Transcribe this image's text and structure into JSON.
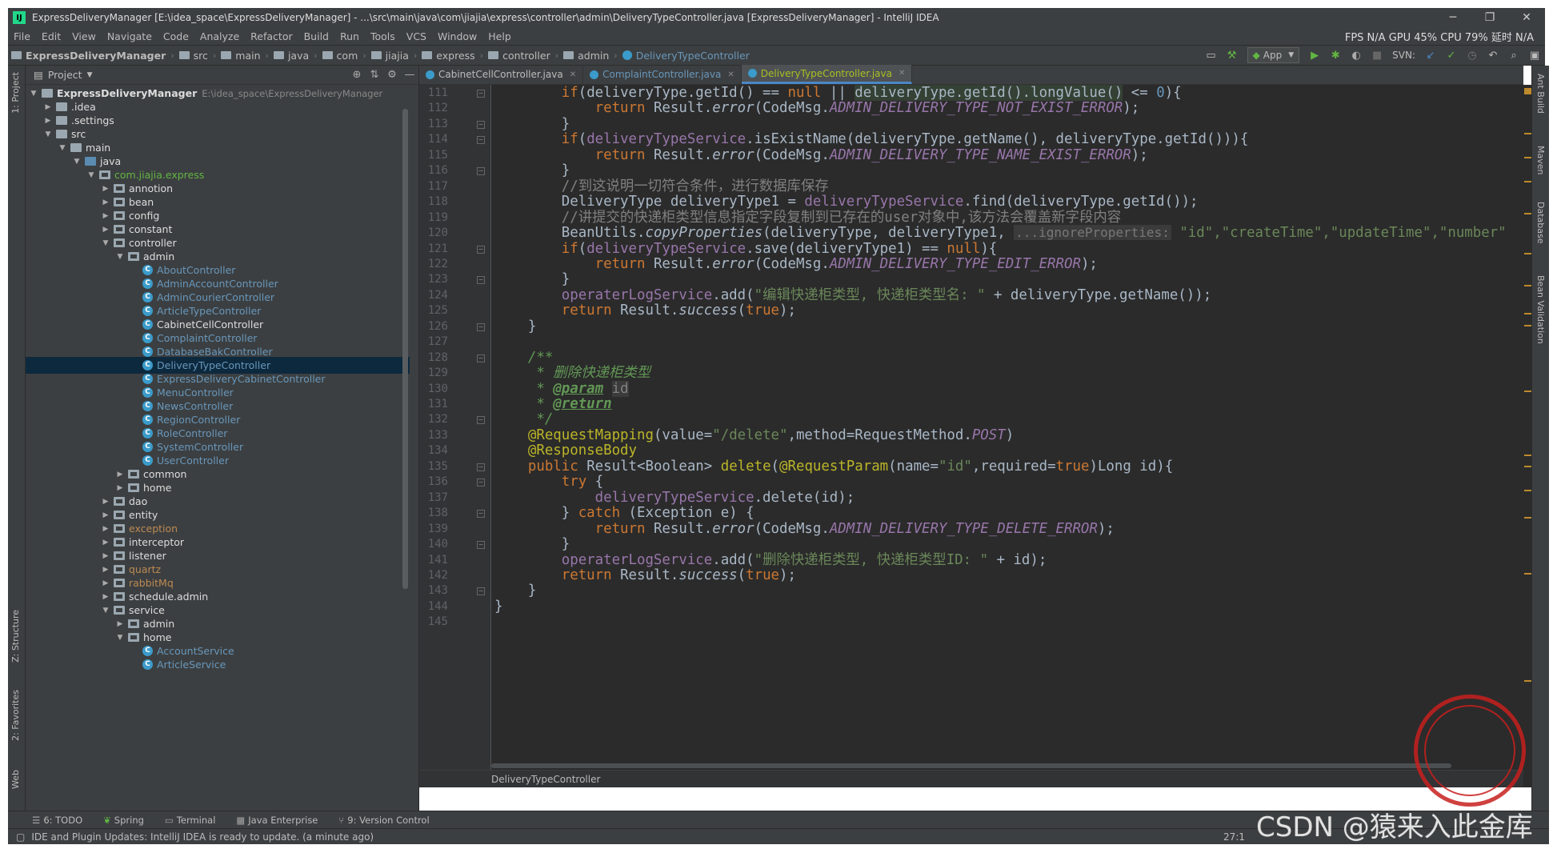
{
  "window": {
    "title": "ExpressDeliveryManager [E:\\idea_space\\ExpressDeliveryManager] - ...\\src\\main\\java\\com\\jiajia\\express\\controller\\admin\\DeliveryTypeController.java [ExpressDeliveryManager] - IntelliJ IDEA",
    "minimize": "─",
    "restore": "❐",
    "close": "✕"
  },
  "menu": {
    "items": [
      "File",
      "Edit",
      "View",
      "Navigate",
      "Code",
      "Analyze",
      "Refactor",
      "Build",
      "Run",
      "Tools",
      "VCS",
      "Window",
      "Help"
    ],
    "stats": "FPS  N/A  GPU  45%  CPU  79%  延时  N/A"
  },
  "nav": {
    "crumbs": [
      "ExpressDeliveryManager",
      "src",
      "main",
      "java",
      "com",
      "jiajia",
      "express",
      "controller",
      "admin",
      "DeliveryTypeController"
    ],
    "run_config": "App",
    "svn_label": "SVN:"
  },
  "left_stripe": {
    "project": "1: Project",
    "structure": "Z: Structure",
    "favorites": "2: Favorites",
    "web": "Web"
  },
  "project_panel": {
    "header": "Project",
    "root_name": "ExpressDeliveryManager",
    "root_path": "E:\\idea_space\\ExpressDeliveryManager",
    "tree": [
      {
        "label": ".idea",
        "indent": 1,
        "arrow": "▶",
        "icon": "folder",
        "color": "white"
      },
      {
        "label": ".settings",
        "indent": 1,
        "arrow": "▶",
        "icon": "folder",
        "color": "white"
      },
      {
        "label": "src",
        "indent": 1,
        "arrow": "▼",
        "icon": "folder",
        "color": "white"
      },
      {
        "label": "main",
        "indent": 2,
        "arrow": "▼",
        "icon": "folder",
        "color": "white"
      },
      {
        "label": "java",
        "indent": 3,
        "arrow": "▼",
        "icon": "src",
        "color": "white"
      },
      {
        "label": "com.jiajia.express",
        "indent": 4,
        "arrow": "▼",
        "icon": "pkg",
        "color": "green"
      },
      {
        "label": "annotion",
        "indent": 5,
        "arrow": "▶",
        "icon": "pkg",
        "color": "white"
      },
      {
        "label": "bean",
        "indent": 5,
        "arrow": "▶",
        "icon": "pkg",
        "color": "white"
      },
      {
        "label": "config",
        "indent": 5,
        "arrow": "▶",
        "icon": "pkg",
        "color": "white"
      },
      {
        "label": "constant",
        "indent": 5,
        "arrow": "▶",
        "icon": "pkg",
        "color": "white"
      },
      {
        "label": "controller",
        "indent": 5,
        "arrow": "▼",
        "icon": "pkg",
        "color": "white"
      },
      {
        "label": "admin",
        "indent": 6,
        "arrow": "▼",
        "icon": "pkg",
        "color": "white"
      },
      {
        "label": "AboutController",
        "indent": 7,
        "arrow": "",
        "icon": "class",
        "color": "blue"
      },
      {
        "label": "AdminAccountController",
        "indent": 7,
        "arrow": "",
        "icon": "class",
        "color": "blue"
      },
      {
        "label": "AdminCourierController",
        "indent": 7,
        "arrow": "",
        "icon": "class",
        "color": "blue"
      },
      {
        "label": "ArticleTypeController",
        "indent": 7,
        "arrow": "",
        "icon": "class",
        "color": "blue"
      },
      {
        "label": "CabinetCellController",
        "indent": 7,
        "arrow": "",
        "icon": "class",
        "color": "white"
      },
      {
        "label": "ComplaintController",
        "indent": 7,
        "arrow": "",
        "icon": "class",
        "color": "blue"
      },
      {
        "label": "DatabaseBakController",
        "indent": 7,
        "arrow": "",
        "icon": "class",
        "color": "blue"
      },
      {
        "label": "DeliveryTypeController",
        "indent": 7,
        "arrow": "",
        "icon": "class",
        "color": "blue",
        "selected": true
      },
      {
        "label": "ExpressDeliveryCabinetController",
        "indent": 7,
        "arrow": "",
        "icon": "class",
        "color": "blue"
      },
      {
        "label": "MenuController",
        "indent": 7,
        "arrow": "",
        "icon": "class",
        "color": "blue"
      },
      {
        "label": "NewsController",
        "indent": 7,
        "arrow": "",
        "icon": "class",
        "color": "blue"
      },
      {
        "label": "RegionController",
        "indent": 7,
        "arrow": "",
        "icon": "class",
        "color": "blue"
      },
      {
        "label": "RoleController",
        "indent": 7,
        "arrow": "",
        "icon": "class",
        "color": "blue"
      },
      {
        "label": "SystemController",
        "indent": 7,
        "arrow": "",
        "icon": "class",
        "color": "blue"
      },
      {
        "label": "UserController",
        "indent": 7,
        "arrow": "",
        "icon": "class",
        "color": "blue"
      },
      {
        "label": "common",
        "indent": 6,
        "arrow": "▶",
        "icon": "pkg",
        "color": "white"
      },
      {
        "label": "home",
        "indent": 6,
        "arrow": "▶",
        "icon": "pkg",
        "color": "white"
      },
      {
        "label": "dao",
        "indent": 5,
        "arrow": "▶",
        "icon": "pkg",
        "color": "white"
      },
      {
        "label": "entity",
        "indent": 5,
        "arrow": "▶",
        "icon": "pkg",
        "color": "white"
      },
      {
        "label": "exception",
        "indent": 5,
        "arrow": "▶",
        "icon": "pkg",
        "color": "orange"
      },
      {
        "label": "interceptor",
        "indent": 5,
        "arrow": "▶",
        "icon": "pkg",
        "color": "white"
      },
      {
        "label": "listener",
        "indent": 5,
        "arrow": "▶",
        "icon": "pkg",
        "color": "white"
      },
      {
        "label": "quartz",
        "indent": 5,
        "arrow": "▶",
        "icon": "pkg",
        "color": "orange"
      },
      {
        "label": "rabbitMq",
        "indent": 5,
        "arrow": "▶",
        "icon": "pkg",
        "color": "orange"
      },
      {
        "label": "schedule.admin",
        "indent": 5,
        "arrow": "▶",
        "icon": "pkg",
        "color": "white"
      },
      {
        "label": "service",
        "indent": 5,
        "arrow": "▼",
        "icon": "pkg",
        "color": "white"
      },
      {
        "label": "admin",
        "indent": 6,
        "arrow": "▶",
        "icon": "pkg",
        "color": "white"
      },
      {
        "label": "home",
        "indent": 6,
        "arrow": "▼",
        "icon": "pkg",
        "color": "white"
      },
      {
        "label": "AccountService",
        "indent": 7,
        "arrow": "",
        "icon": "class",
        "color": "blue"
      },
      {
        "label": "ArticleService",
        "indent": 7,
        "arrow": "",
        "icon": "class",
        "color": "blue"
      }
    ]
  },
  "editor": {
    "tabs": [
      {
        "label": "CabinetCellController.java",
        "active": false
      },
      {
        "label": "ComplaintController.java",
        "active": false
      },
      {
        "label": "DeliveryTypeController.java",
        "active": true
      }
    ],
    "first_line": 111,
    "line_numbers": [
      "111",
      "112",
      "113",
      "114",
      "115",
      "116",
      "117",
      "118",
      "119",
      "120",
      "121",
      "122",
      "123",
      "124",
      "125",
      "126",
      "127",
      "128",
      "129",
      "130",
      "131",
      "132",
      "133",
      "134",
      "135",
      "136",
      "137",
      "138",
      "139",
      "140",
      "141",
      "142",
      "143",
      "144",
      "145"
    ],
    "bottom_breadcrumb": "DeliveryTypeController"
  },
  "code": {
    "l111": [
      "        ",
      "if",
      "(deliveryType.getId() == ",
      "null",
      " || ",
      "deliveryType.getId().longValue()",
      " <= ",
      "0",
      "){"
    ],
    "l112": [
      "            ",
      "return",
      " Result.",
      "error",
      "(CodeMsg.",
      "ADMIN_DELIVERY_TYPE_NOT_EXIST_ERROR",
      ");"
    ],
    "l113": [
      "        }"
    ],
    "l114": [
      "        ",
      "if",
      "(",
      "deliveryTypeService",
      ".isExistName(deliveryType.getName(), deliveryType.getId())){"
    ],
    "l115": [
      "            ",
      "return",
      " Result.",
      "error",
      "(CodeMsg.",
      "ADMIN_DELIVERY_TYPE_NAME_EXIST_ERROR",
      ");"
    ],
    "l116": [
      "        }"
    ],
    "l117": [
      "        //到这说明一切符合条件，进行数据库保存"
    ],
    "l118": [
      "        DeliveryType deliveryType1 = ",
      "deliveryTypeService",
      ".find(deliveryType.getId());"
    ],
    "l119": [
      "        //讲提交的快递柜类型信息指定字段复制到已存在的user对象中,该方法会覆盖新字段内容"
    ],
    "l120": [
      "        BeanUtils.",
      "copyProperties",
      "(deliveryType, deliveryType1, ",
      "...ignoreProperties:",
      " ",
      "\"id\",\"createTime\",\"updateTime\",\"number\""
    ],
    "l121": [
      "        ",
      "if",
      "(",
      "deliveryTypeService",
      ".save(deliveryType1) == ",
      "null",
      "){"
    ],
    "l122": [
      "            ",
      "return",
      " Result.",
      "error",
      "(CodeMsg.",
      "ADMIN_DELIVERY_TYPE_EDIT_ERROR",
      ");"
    ],
    "l123": [
      "        }"
    ],
    "l124": [
      "        ",
      "operaterLogService",
      ".add(",
      "\"编辑快递柜类型, 快递柜类型名: \"",
      " + deliveryType.getName());"
    ],
    "l125": [
      "        ",
      "return",
      " Result.",
      "success",
      "(",
      "true",
      ");"
    ],
    "l126": [
      "    }"
    ],
    "l127": [
      ""
    ],
    "l128": [
      "    /**"
    ],
    "l129": [
      "     * 删除快递柜类型"
    ],
    "l130": [
      "     * ",
      "@param",
      " ",
      "id"
    ],
    "l131": [
      "     * ",
      "@return"
    ],
    "l132": [
      "     */"
    ],
    "l133": [
      "    ",
      "@RequestMapping",
      "(value=",
      "\"/delete\"",
      ",method=RequestMethod.",
      "POST",
      ")"
    ],
    "l134": [
      "    ",
      "@ResponseBody"
    ],
    "l135": [
      "    ",
      "public",
      " Result<Boolean> ",
      "delete",
      "(",
      "@RequestParam",
      "(name=",
      "\"id\"",
      ",required=",
      "true",
      ")Long id){"
    ],
    "l136": [
      "        ",
      "try",
      " {"
    ],
    "l137": [
      "            ",
      "deliveryTypeService",
      ".delete(id);"
    ],
    "l138": [
      "        } ",
      "catch",
      " (Exception e) {"
    ],
    "l139": [
      "            ",
      "return",
      " Result.",
      "error",
      "(CodeMsg.",
      "ADMIN_DELIVERY_TYPE_DELETE_ERROR",
      ");"
    ],
    "l140": [
      "        }"
    ],
    "l141": [
      "        ",
      "operaterLogService",
      ".add(",
      "\"删除快递柜类型, 快递柜类型ID: \"",
      " + id);"
    ],
    "l142": [
      "        ",
      "return",
      " Result.",
      "success",
      "(",
      "true",
      ");"
    ],
    "l143": [
      "    }"
    ],
    "l144": [
      "}"
    ],
    "l145": [
      ""
    ]
  },
  "right_stripe": {
    "ant": "Ant Build",
    "maven": "Maven",
    "database": "Database",
    "bean": "Bean Validation"
  },
  "bottom_tools": [
    "6: TODO",
    "Spring",
    "Terminal",
    "Java Enterprise",
    "9: Version Control"
  ],
  "status": {
    "message": "IDE and Plugin Updates: IntelliJ IDEA is ready to update. (a minute ago)",
    "position": "27:1"
  },
  "watermark": {
    "text": "CSDN @猿来入此金库"
  },
  "colors": {
    "accent": "#4a88c7",
    "keyword": "#cc7832",
    "string": "#6a8759",
    "field": "#9876aa",
    "comment": "#808080",
    "doc": "#629755",
    "annotation": "#bbb529",
    "background": "#2b2b2b",
    "seal": "#c7201e"
  }
}
